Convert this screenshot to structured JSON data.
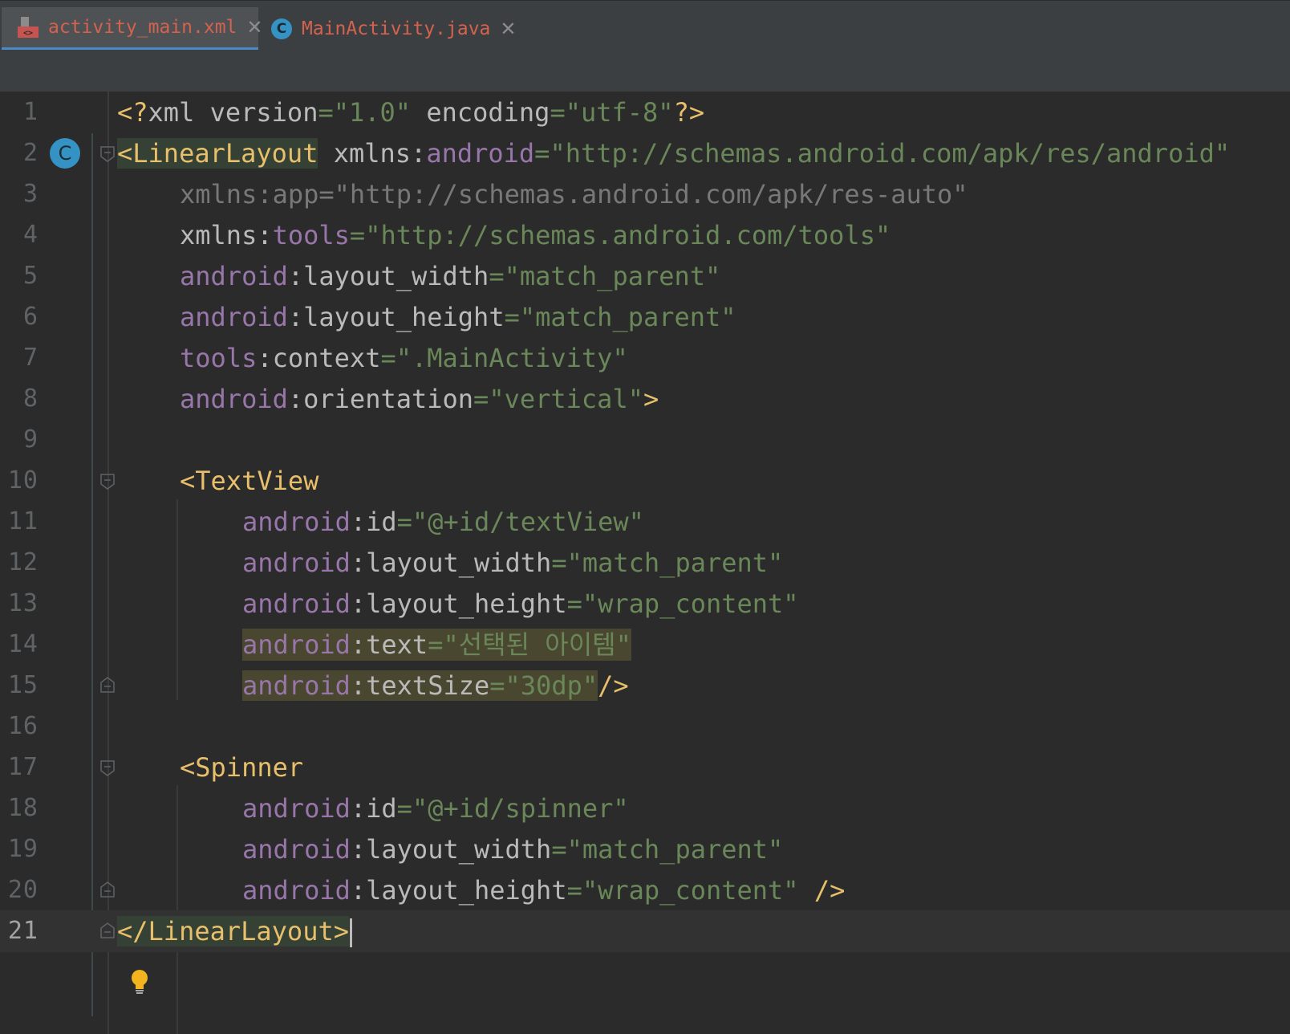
{
  "tabs": [
    {
      "label": "activity_main.xml",
      "icon": "xml-file-icon",
      "active": true
    },
    {
      "label": "MainActivity.java",
      "icon": "class-icon",
      "icon_letter": "C",
      "active": false
    }
  ],
  "gutter": {
    "class_icon_letter": "C",
    "intention_icon": "lightbulb-icon"
  },
  "lines": [
    {
      "n": "1"
    },
    {
      "n": "2"
    },
    {
      "n": "3"
    },
    {
      "n": "4"
    },
    {
      "n": "5"
    },
    {
      "n": "6"
    },
    {
      "n": "7"
    },
    {
      "n": "8"
    },
    {
      "n": "9"
    },
    {
      "n": "10"
    },
    {
      "n": "11"
    },
    {
      "n": "12"
    },
    {
      "n": "13"
    },
    {
      "n": "14"
    },
    {
      "n": "15"
    },
    {
      "n": "16"
    },
    {
      "n": "17"
    },
    {
      "n": "18"
    },
    {
      "n": "19"
    },
    {
      "n": "20"
    },
    {
      "n": "21"
    }
  ],
  "code": {
    "l1": {
      "open": "<?",
      "xml": "xml ",
      "a1": "version",
      "eq1": "=",
      "v1": "\"1.0\"",
      "sp": " ",
      "a2": "encoding",
      "eq2": "=",
      "v2": "\"utf-8\"",
      "close": "?>"
    },
    "l2": {
      "tag": "<LinearLayout",
      "sp": " ",
      "a1": "xmlns:",
      "ns": "android",
      "eq": "=",
      "v": "\"http://schemas.android.com/apk/res/android\""
    },
    "l3": {
      "text": "xmlns:app=\"http://schemas.android.com/apk/res-auto\""
    },
    "l4": {
      "a": "xmlns:",
      "ns": "tools",
      "eq": "=",
      "v": "\"http://schemas.android.com/tools\""
    },
    "l5": {
      "ns": "android",
      "a": ":layout_width",
      "eq": "=",
      "v": "\"match_parent\""
    },
    "l6": {
      "ns": "android",
      "a": ":layout_height",
      "eq": "=",
      "v": "\"match_parent\""
    },
    "l7": {
      "ns": "tools",
      "a": ":context",
      "eq": "=",
      "v": "\".MainActivity\""
    },
    "l8": {
      "ns": "android",
      "a": ":orientation",
      "eq": "=",
      "v": "\"vertical\"",
      "close": ">"
    },
    "l10": {
      "tag": "<TextView"
    },
    "l11": {
      "ns": "android",
      "a": ":id",
      "eq": "=",
      "v": "\"@+id/textView\""
    },
    "l12": {
      "ns": "android",
      "a": ":layout_width",
      "eq": "=",
      "v": "\"match_parent\""
    },
    "l13": {
      "ns": "android",
      "a": ":layout_height",
      "eq": "=",
      "v": "\"wrap_content\""
    },
    "l14": {
      "ns": "android",
      "a": ":text",
      "eq": "=",
      "v": "\"선택된 아이템\""
    },
    "l15": {
      "ns": "android",
      "a": ":textSize",
      "eq": "=",
      "v": "\"30dp\"",
      "close": "/>"
    },
    "l17": {
      "tag": "<Spinner"
    },
    "l18": {
      "ns": "android",
      "a": ":id",
      "eq": "=",
      "v": "\"@+id/spinner\""
    },
    "l19": {
      "ns": "android",
      "a": ":layout_width",
      "eq": "=",
      "v": "\"match_parent\""
    },
    "l20": {
      "ns": "android",
      "a": ":layout_height",
      "eq": "=",
      "v": "\"wrap_content\"",
      "sp": " ",
      "close": "/>"
    },
    "l21": {
      "tag": "</LinearLayout>"
    }
  },
  "colors": {
    "background": "#2b2b2b",
    "tag": "#e8bf6a",
    "namespace": "#9876aa",
    "value": "#6a8759",
    "attribute": "#bababa",
    "active_tab_underline": "#4a88c7",
    "tab_label": "#d4624e"
  }
}
